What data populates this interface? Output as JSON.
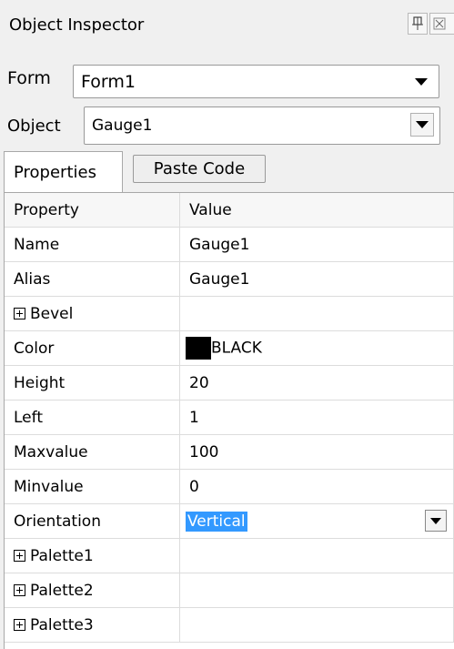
{
  "window": {
    "title": "Object Inspector"
  },
  "form_selector": {
    "label": "Form",
    "value": "Form1"
  },
  "object_selector": {
    "label": "Object",
    "value": "Gauge1"
  },
  "tabs": {
    "properties": "Properties",
    "paste_code": "Paste Code"
  },
  "grid": {
    "header": {
      "property": "Property",
      "value": "Value"
    },
    "rows": [
      {
        "name": "Name",
        "value": "Gauge1"
      },
      {
        "name": "Alias",
        "value": "Gauge1"
      },
      {
        "name": "Bevel",
        "value": ""
      },
      {
        "name": "Color",
        "value": "BLACK"
      },
      {
        "name": "Height",
        "value": "20"
      },
      {
        "name": "Left",
        "value": "1"
      },
      {
        "name": "Maxvalue",
        "value": "100"
      },
      {
        "name": "Minvalue",
        "value": "0"
      },
      {
        "name": "Orientation",
        "value": "Vertical"
      },
      {
        "name": "Palette1",
        "value": ""
      },
      {
        "name": "Palette2",
        "value": ""
      },
      {
        "name": "Palette3",
        "value": ""
      }
    ]
  },
  "colors": {
    "selection": "#3399ff",
    "color_swatch": "#000000"
  }
}
